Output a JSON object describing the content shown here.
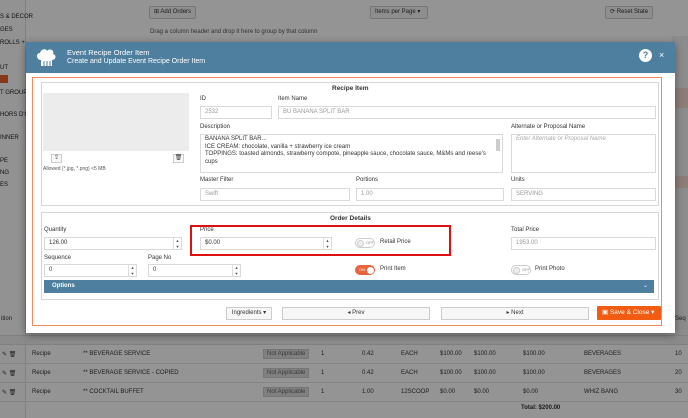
{
  "background": {
    "sidebar_items": [
      "S & DECOR",
      "GES",
      "ROLLS + ...",
      "UT",
      "T GROUP",
      "HORS D'O",
      "INNER",
      "PE",
      "NG",
      "ES"
    ],
    "add_orders": "Add Orders",
    "items_per_page": "Items per Page",
    "reset_state": "Reset State",
    "group_hint": "Drag a column header and drop it here to group by that column",
    "grid_col_left": "ition",
    "grid_col_right": "Seq",
    "rows": [
      {
        "type": "Recipe",
        "name": "** BEVERAGE SERVICE",
        "status": "Not Applicable",
        "qty": "1",
        "portions": "0.42",
        "unit": "EACH",
        "p1": "$100.00",
        "p2": "$100.00",
        "p3": "$100.00",
        "category": "BEVERAGES",
        "seq": "10"
      },
      {
        "type": "Recipe",
        "name": "** BEVERAGE SERVICE - COPIED",
        "status": "Not Applicable",
        "qty": "1",
        "portions": "0.42",
        "unit": "EACH",
        "p1": "$100.00",
        "p2": "$100.00",
        "p3": "$100.00",
        "category": "BEVERAGES",
        "seq": "20"
      },
      {
        "type": "Recipe",
        "name": "** COCKTAIL BUFFET",
        "status": "Not Applicable",
        "qty": "1",
        "portions": "1.00",
        "unit": "12SCOOP",
        "p1": "$0.00",
        "p2": "$0.00",
        "p3": "$0.00",
        "category": "WHIZ BANG",
        "seq": "30"
      }
    ],
    "total": "Total: $200.00"
  },
  "modal": {
    "title": "Event Recipe Order Item",
    "subtitle": "Create and Update Event Recipe Order Item",
    "help": "?",
    "close": "×",
    "recipe_item": {
      "section_title": "Recipe Item",
      "allowed_text": "Allowed (*.jpg, *.png) <5 MB",
      "id_label": "ID",
      "id_value": "2532",
      "item_name_label": "Item Name",
      "item_name_value": "BU BANANA SPLIT BAR",
      "description_label": "Description",
      "description_lines": [
        "BANANA SPLIT BAR...",
        "ICE CREAM: chocolate, vanilla + strawberry ice cream",
        "TOPPINGS: toasted almonds, strawberry compote, pineapple sauce, chocolate sauce, M&Ms and reese's",
        "cups"
      ],
      "alternate_label": "Alternate or Proposal Name",
      "alternate_placeholder": "Enter Alternate or Proposal Name",
      "master_filter_label": "Master Filter",
      "master_filter_value": "Swift",
      "portions_label": "Portions",
      "portions_value": "1.00",
      "units_label": "Units",
      "units_value": "SERVING"
    },
    "order_details": {
      "section_title": "Order Details",
      "quantity_label": "Quantity",
      "quantity_value": "126.00",
      "price_label": "Price",
      "price_value": "$0.00",
      "retail_price_label": "Retail Price",
      "retail_price_toggle": "OFF",
      "total_price_label": "Total Price",
      "total_price_value": "1953.00",
      "sequence_label": "Sequence",
      "sequence_value": "0",
      "page_no_label": "Page No",
      "page_no_value": "0",
      "print_item_label": "Print Item",
      "print_item_toggle": "ON",
      "print_photo_label": "Print Photo",
      "print_photo_toggle": "OFF",
      "options_label": "Options"
    },
    "footer": {
      "ingredients": "Ingredients",
      "prev": "◂ Prev",
      "next": "▸ Next",
      "save_close": "Save & Close"
    }
  },
  "colors": {
    "header_blue": "#4e7f9f",
    "accent_orange": "#f25b12",
    "highlight_red": "#dd1111"
  }
}
